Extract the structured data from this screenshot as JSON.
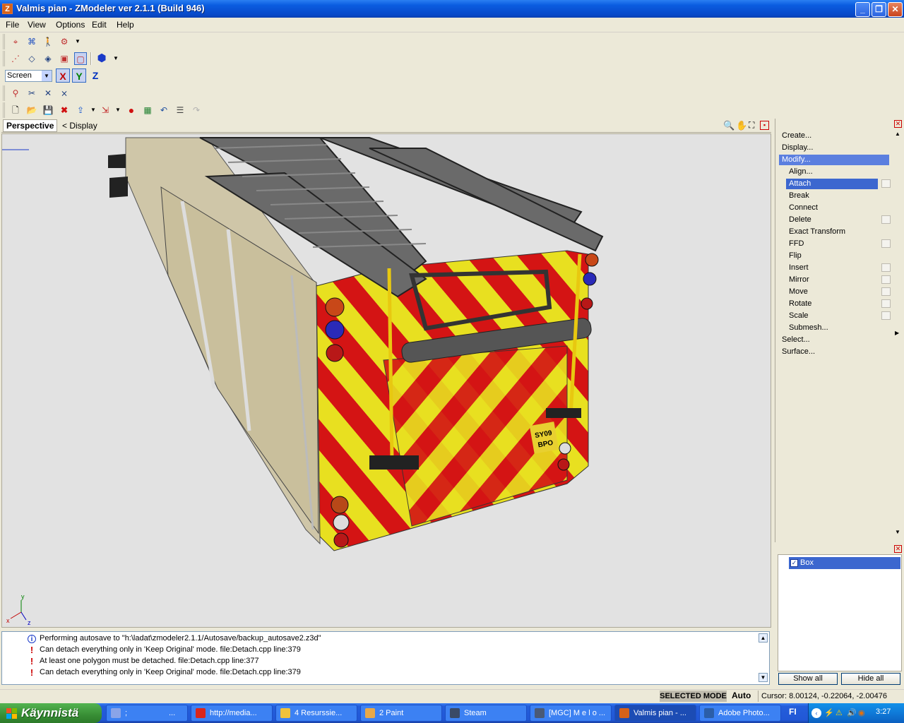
{
  "window": {
    "title": "Valmis pian - ZModeler ver 2.1.1 (Build 946)"
  },
  "menu": {
    "file": "File",
    "view": "View",
    "options": "Options",
    "edit": "Edit",
    "help": "Help"
  },
  "toolbar": {
    "coordinate_system": "Screen",
    "axis_x": "X",
    "axis_y": "Y",
    "axis_z": "Z"
  },
  "viewport": {
    "tab_label": "Perspective",
    "display_label": "< Display",
    "axis_x": "x",
    "axis_y": "y",
    "axis_z": "z",
    "plate_line1": "SY09",
    "plate_line2": "BPO"
  },
  "command_tree": {
    "items": [
      {
        "label": "Create...",
        "level": 0,
        "state": "normal",
        "has_options": false
      },
      {
        "label": "Display...",
        "level": 0,
        "state": "normal",
        "has_options": false
      },
      {
        "label": "Modify...",
        "level": 0,
        "state": "expanded",
        "has_options": false
      },
      {
        "label": "Align...",
        "level": 1,
        "state": "normal",
        "has_options": false
      },
      {
        "label": "Attach",
        "level": 1,
        "state": "selected",
        "has_options": true
      },
      {
        "label": "Break",
        "level": 1,
        "state": "normal",
        "has_options": false
      },
      {
        "label": "Connect",
        "level": 1,
        "state": "normal",
        "has_options": false
      },
      {
        "label": "Delete",
        "level": 1,
        "state": "normal",
        "has_options": true
      },
      {
        "label": "Exact Transform",
        "level": 1,
        "state": "normal",
        "has_options": false
      },
      {
        "label": "FFD",
        "level": 1,
        "state": "normal",
        "has_options": true
      },
      {
        "label": "Flip",
        "level": 1,
        "state": "normal",
        "has_options": false
      },
      {
        "label": "Insert",
        "level": 1,
        "state": "normal",
        "has_options": true
      },
      {
        "label": "Mirror",
        "level": 1,
        "state": "normal",
        "has_options": true
      },
      {
        "label": "Move",
        "level": 1,
        "state": "normal",
        "has_options": true
      },
      {
        "label": "Rotate",
        "level": 1,
        "state": "normal",
        "has_options": true
      },
      {
        "label": "Scale",
        "level": 1,
        "state": "normal",
        "has_options": true
      },
      {
        "label": "Submesh...",
        "level": 1,
        "state": "normal",
        "has_options": false
      },
      {
        "label": "Select...",
        "level": 0,
        "state": "normal",
        "has_options": false
      },
      {
        "label": "Surface...",
        "level": 0,
        "state": "normal",
        "has_options": false
      }
    ]
  },
  "scene": {
    "object_name": "Box",
    "show_all": "Show all",
    "hide_all": "Hide all"
  },
  "log": {
    "lines": [
      {
        "type": "info",
        "text": "Performing autosave to \"h:\\ladat\\zmodeler2.1.1/Autosave/backup_autosave2.z3d\""
      },
      {
        "type": "warning",
        "text": "Can detach everything only in 'Keep Original' mode. file:Detach.cpp line:379"
      },
      {
        "type": "warning",
        "text": "At least one polygon must be detached. file:Detach.cpp line:377"
      },
      {
        "type": "warning",
        "text": "Can detach everything only in 'Keep Original' mode. file:Detach.cpp line:379"
      }
    ]
  },
  "status": {
    "mode": "SELECTED MODE",
    "auto": "Auto",
    "cursor": "Cursor: 8.00124, -0.22064, -2.00476"
  },
  "taskbar": {
    "start": "Käynnistä",
    "tasks": [
      {
        "label": ";",
        "extra": "...",
        "icon_color": "#8aa4e8"
      },
      {
        "label": "http://media...",
        "icon_color": "#d9261c"
      },
      {
        "label": "4 Resurssie...",
        "icon_color": "#f0c23c"
      },
      {
        "label": "2 Paint",
        "icon_color": "#e8a848"
      },
      {
        "label": "Steam",
        "icon_color": "#3a4a66"
      },
      {
        "label": "[MGC] M e l o ...",
        "icon_color": "#4a5a76"
      },
      {
        "label": "Valmis pian - ...",
        "icon_color": "#d7621a"
      },
      {
        "label": "Adobe Photo...",
        "icon_color": "#2b5ea8"
      }
    ],
    "language": "FI",
    "clock": "3:27"
  },
  "colors": {
    "selection": "#3c67cf",
    "accent_blue": "#0a5ce0",
    "error": "#cc0000"
  }
}
